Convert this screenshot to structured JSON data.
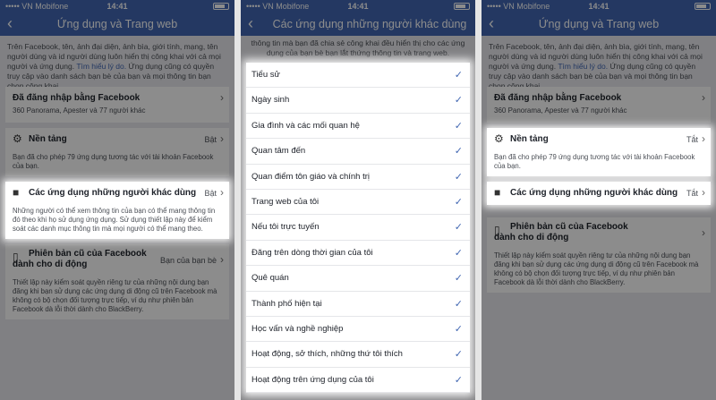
{
  "status": {
    "carrier": "••••• VN Mobifone",
    "time": "14:41"
  },
  "panel1": {
    "title": "Ứng dụng và Trang web",
    "intro": "Trên Facebook, tên, ảnh đại diện, ảnh bìa, giới tính, mạng, tên người dùng và id người dùng luôn hiển thị công khai với cả mọi người và ứng dụng.",
    "intro_link": "Tìm hiểu lý do.",
    "intro_tail": "Ứng dụng cũng có quyền truy cập vào danh sách bạn bè của bạn và mọi thông tin bạn chọn công khai.",
    "login_label": "Đã đăng nhập bằng Facebook",
    "login_sub": "360 Panorama, Apester và 77 người khác",
    "platform_label": "Nền tảng",
    "platform_value": "Bật",
    "platform_desc": "Bạn đã cho phép 79 ứng dụng tương tác với tài khoản Facebook của bạn.",
    "others_label": "Các ứng dụng những người khác dùng",
    "others_value": "Bật",
    "others_desc": "Những người có thể xem thông tin của bạn có thể mang thông tin đó theo khi họ sử dụng ứng dụng. Sử dụng thiết lập này để kiểm soát các danh mục thông tin mà mọi người có thể mang theo.",
    "legacy_label_1": "Phiên bản cũ của Facebook",
    "legacy_label_2": "dành cho di động",
    "legacy_value": "Bạn của bạn bè",
    "legacy_desc": "Thiết lập này kiểm soát quyền riêng tư của những nội dung bạn đăng khi bạn sử dụng các ứng dụng di động cũ trên Facebook mà không có bộ chọn đối tượng trực tiếp, ví dụ như phiên bản Facebook dà lỗi thời dành cho BlackBerry."
  },
  "panel2": {
    "title": "Các ứng dụng những người khác dùng",
    "intro": "thông tin mà bạn đã chia sẻ công khai đều hiển thị cho các ứng dụng của bạn bè bạn lắt thứng thông tin và trang web.",
    "items": [
      "Tiểu sử",
      "Ngày sinh",
      "Gia đình và các mối quan hệ",
      "Quan tâm đến",
      "Quan điểm tôn giáo và chính trị",
      "Trang web của tôi",
      "Nếu tôi trực tuyến",
      "Đăng trên dòng thời gian của tôi",
      "Quê quán",
      "Thành phố hiện tại",
      "Học vấn và nghề nghiệp",
      "Hoạt động, sở thích, những thứ tôi thích",
      "Hoạt động trên ứng dụng của tôi"
    ],
    "check": "✓"
  },
  "panel3": {
    "title": "Ứng dụng và Trang web",
    "platform_value": "Tắt",
    "others_value": "Tắt"
  },
  "colors": {
    "brand": "#4267b2"
  }
}
